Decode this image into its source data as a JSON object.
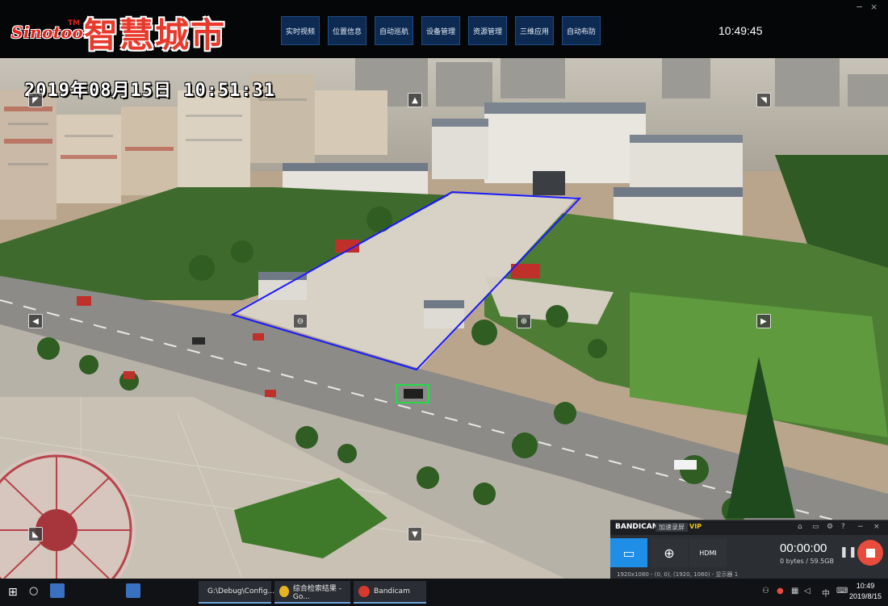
{
  "header": {
    "brand": "Sinotoon",
    "brand_tm": "TM",
    "title": "智慧城市",
    "clock": "10:49:45",
    "nav": [
      {
        "label": "实时视频"
      },
      {
        "label": "位置信息"
      },
      {
        "label": "自动巡航"
      },
      {
        "label": "设备管理"
      },
      {
        "label": "资源管理"
      },
      {
        "label": "三维应用"
      },
      {
        "label": "自动布防"
      }
    ],
    "win_min": "−",
    "win_close": "×"
  },
  "video": {
    "osd_timestamp": "2019年08月15日 10:51:31",
    "ptz": {
      "up_left": "◤",
      "up": "▲",
      "up_right": "◥",
      "left": "◀",
      "zoom_out": "⊖",
      "zoom_in": "⊕",
      "right": "▶",
      "down_left": "◣",
      "down": "▼"
    }
  },
  "bandicam": {
    "name": "BANDICAM",
    "register": "加速录屏",
    "vip": "VIP",
    "rec_time": "00:00:00",
    "file_size": "0 bytes / 59.5GB",
    "resolution": "1920x1080 - (0, 0), (1920, 1080) - 显示器 1",
    "head_icons": [
      "⌂",
      "▭",
      "⚙",
      "?",
      "−",
      "×"
    ],
    "modes": [
      {
        "name": "screen",
        "glyph": "▭"
      },
      {
        "name": "game",
        "glyph": "⊕"
      },
      {
        "name": "hdmi",
        "glyph": "HDMI"
      }
    ]
  },
  "taskbar": {
    "start": "⊞",
    "search": "○",
    "tasks": [
      {
        "label": "G:\\Debug\\Config...",
        "color": "#d9a83a"
      },
      {
        "label": "综合检索结果 - Go...",
        "color": "#e6b422"
      },
      {
        "label": "Bandicam",
        "color": "#d63a2e"
      }
    ],
    "tray": "中",
    "time": "10:49",
    "date": "2019/8/15"
  },
  "colors": {
    "nav_bg": "#0d2a52",
    "title_red": "#e83a2c",
    "roi_line": "#1a1aff",
    "detect_box": "#27d84a",
    "bandicam_stop": "#e74c3c"
  }
}
